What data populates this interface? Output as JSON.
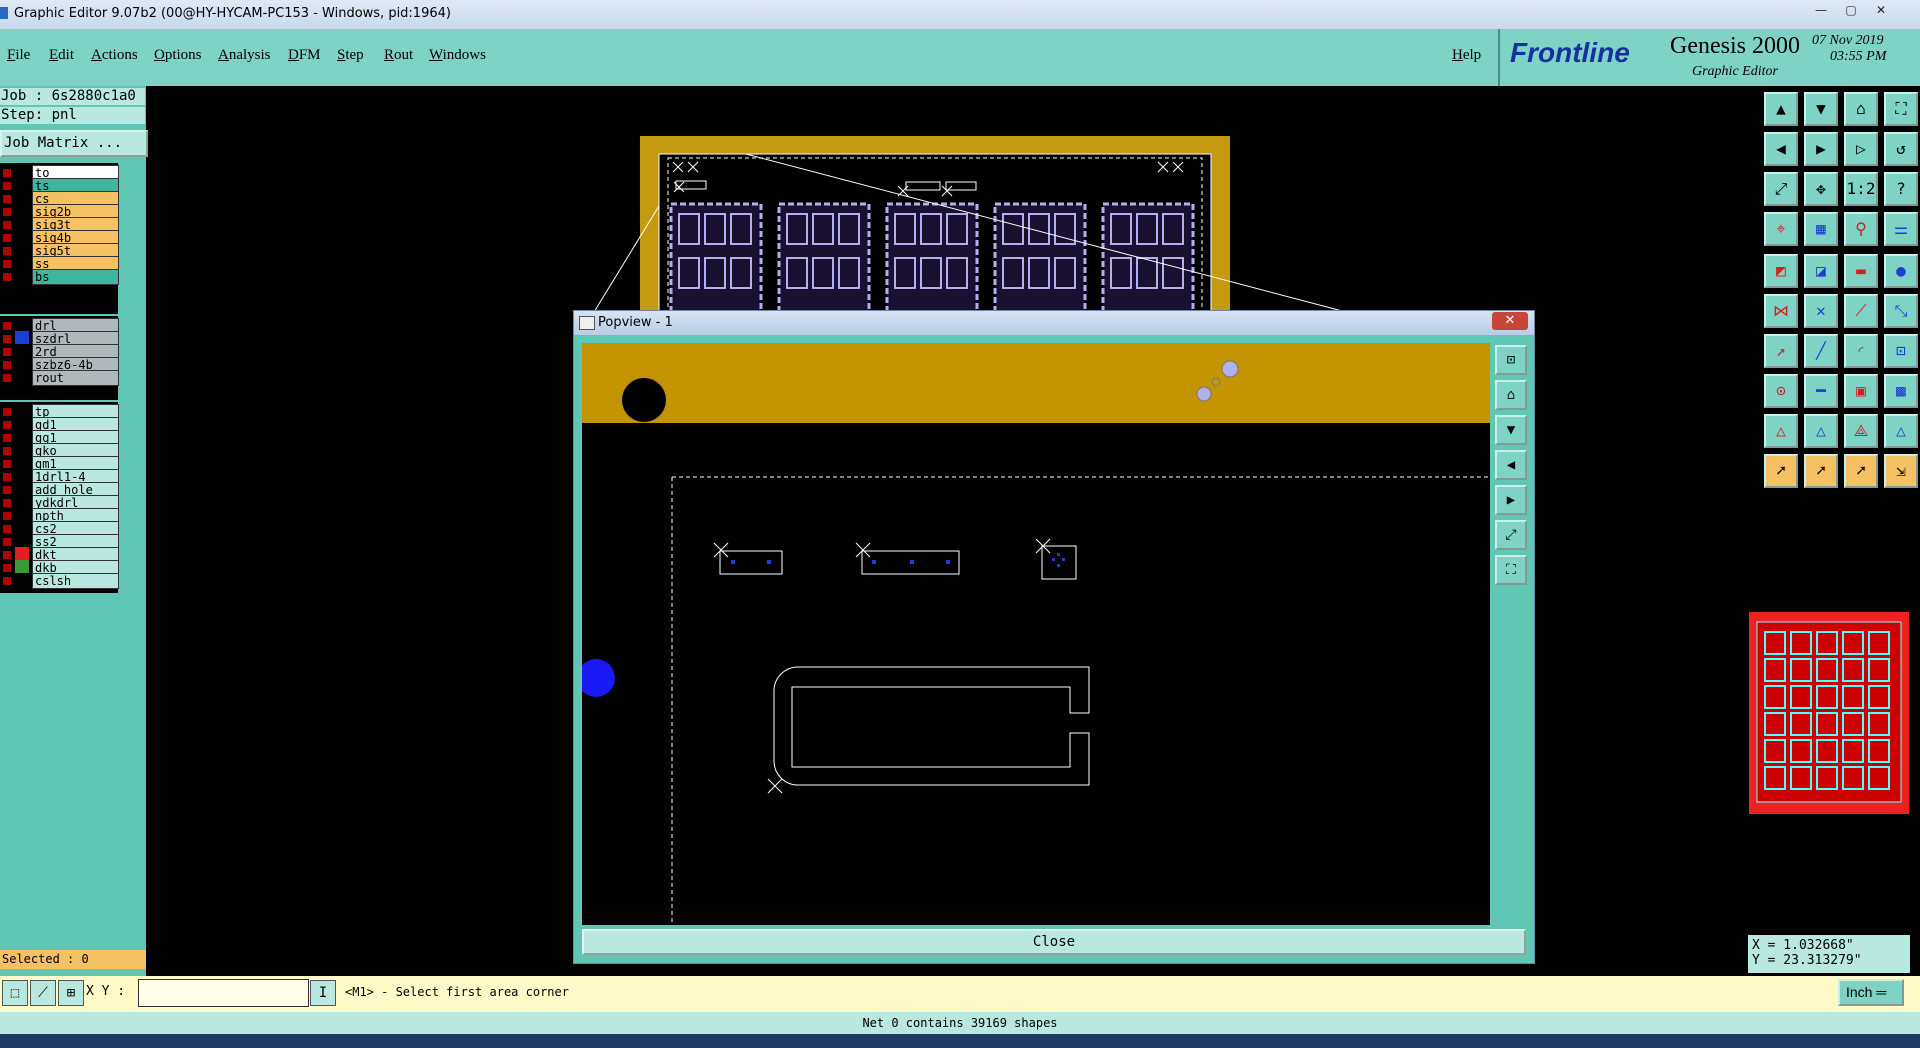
{
  "window": {
    "title": "Graphic Editor 9.07b2 (00@HY-HYCAM-PC153 - Windows, pid:1964)",
    "min": "—",
    "max": "▢",
    "close": "✕"
  },
  "menu": {
    "items": [
      "File",
      "Edit",
      "Actions",
      "Options",
      "Analysis",
      "DFM",
      "Step",
      "Rout",
      "Windows"
    ],
    "help": "Help"
  },
  "brand": {
    "logo": "Frontline",
    "product": "Genesis 2000",
    "subtitle": "Graphic Editor",
    "date": "07 Nov 2019",
    "time": "03:55 PM"
  },
  "job": {
    "job_label": "Job : 6s2880c1a0",
    "step_label": "Step: pnl",
    "matrix_button": "Job Matrix ..."
  },
  "layers": {
    "group1": [
      {
        "name": "to",
        "color": "#ffffff",
        "swatch": "#000000"
      },
      {
        "name": "ts",
        "color": "#3fb59f",
        "swatch": "#000000"
      },
      {
        "name": "cs",
        "color": "#f5c163",
        "swatch": "#000000"
      },
      {
        "name": "sig2b",
        "color": "#f5c163",
        "swatch": "#000000"
      },
      {
        "name": "sig3t",
        "color": "#f5c163",
        "swatch": "#000000"
      },
      {
        "name": "sig4b",
        "color": "#f5c163",
        "swatch": "#000000"
      },
      {
        "name": "sig5t",
        "color": "#f5c163",
        "swatch": "#000000"
      },
      {
        "name": "ss",
        "color": "#f5c163",
        "swatch": "#000000"
      },
      {
        "name": "bs",
        "color": "#3fb59f",
        "swatch": "#000000"
      }
    ],
    "group2": [
      {
        "name": "drl",
        "color": "#b0b8bc",
        "swatch": "#000000"
      },
      {
        "name": "szdrl",
        "color": "#b0b8bc",
        "swatch": "#1a3fd6"
      },
      {
        "name": "2rd",
        "color": "#b0b8bc",
        "swatch": "#000000"
      },
      {
        "name": "szbz6-4b",
        "color": "#b0b8bc",
        "swatch": "#000000"
      },
      {
        "name": "rout",
        "color": "#b0b8bc",
        "swatch": "#000000"
      }
    ],
    "group3": [
      {
        "name": "tp",
        "color": "#b8e8e0",
        "swatch": "#000000"
      },
      {
        "name": "gd1",
        "color": "#b8e8e0",
        "swatch": "#000000"
      },
      {
        "name": "gg1",
        "color": "#b8e8e0",
        "swatch": "#000000"
      },
      {
        "name": "gko",
        "color": "#b8e8e0",
        "swatch": "#000000"
      },
      {
        "name": "gm1",
        "color": "#b8e8e0",
        "swatch": "#000000"
      },
      {
        "name": "1drl1-4",
        "color": "#b8e8e0",
        "swatch": "#000000"
      },
      {
        "name": "add_hole",
        "color": "#b8e8e0",
        "swatch": "#000000"
      },
      {
        "name": "ydkdrl",
        "color": "#b8e8e0",
        "swatch": "#000000"
      },
      {
        "name": "npth",
        "color": "#b8e8e0",
        "swatch": "#000000"
      },
      {
        "name": "cs2",
        "color": "#b8e8e0",
        "swatch": "#000000"
      },
      {
        "name": "ss2",
        "color": "#b8e8e0",
        "swatch": "#000000"
      },
      {
        "name": "dkt",
        "color": "#b8e8e0",
        "swatch": "#e02020"
      },
      {
        "name": "dkb",
        "color": "#b8e8e0",
        "swatch": "#3a9a3a"
      },
      {
        "name": "cslsh",
        "color": "#b8e8e0",
        "swatch": "#000000"
      }
    ]
  },
  "selected": "Selected : 0",
  "popview": {
    "title": "Popview - 1",
    "close_label": "Close",
    "side_icons": [
      "zoom-box",
      "home",
      "page-down",
      "page-left",
      "page-right",
      "fit-window",
      "fit-screen"
    ]
  },
  "toolbar_icons": [
    [
      "layer-up",
      "layer-down",
      "home-view",
      "fit-all"
    ],
    [
      "pan-left",
      "pan-right",
      "page-right",
      "undo-redo"
    ],
    [
      "zoom-fit",
      "zoom-center",
      "scale-1-2",
      "help"
    ],
    [
      "measure",
      "grid",
      "snap-red",
      "snap-multi"
    ],
    [
      "feature-pad",
      "feature-line",
      "ruler",
      "circle"
    ],
    [
      "node-net",
      "cross",
      "connect-line",
      "net-diagonal"
    ],
    [
      "arrow-red",
      "line-draw",
      "arc",
      "drill-copy"
    ],
    [
      "select-net",
      "line-red",
      "frame-select",
      "region"
    ],
    [
      "triangle-red",
      "triangle-blue",
      "triangle-edit",
      "triangle-outline"
    ],
    [
      "pointer",
      "pointer-2",
      "pointer-3",
      "pointer-route"
    ]
  ],
  "coords": {
    "x": "X = 1.032668\"",
    "y": "Y = 23.313279\""
  },
  "bottom": {
    "xy_label": "X Y :",
    "xy_value": "",
    "info_button": "I",
    "prompt": "<M1> - Select first area corner",
    "units": "Inch ═"
  },
  "status": "Net 0 contains 39169 shapes"
}
